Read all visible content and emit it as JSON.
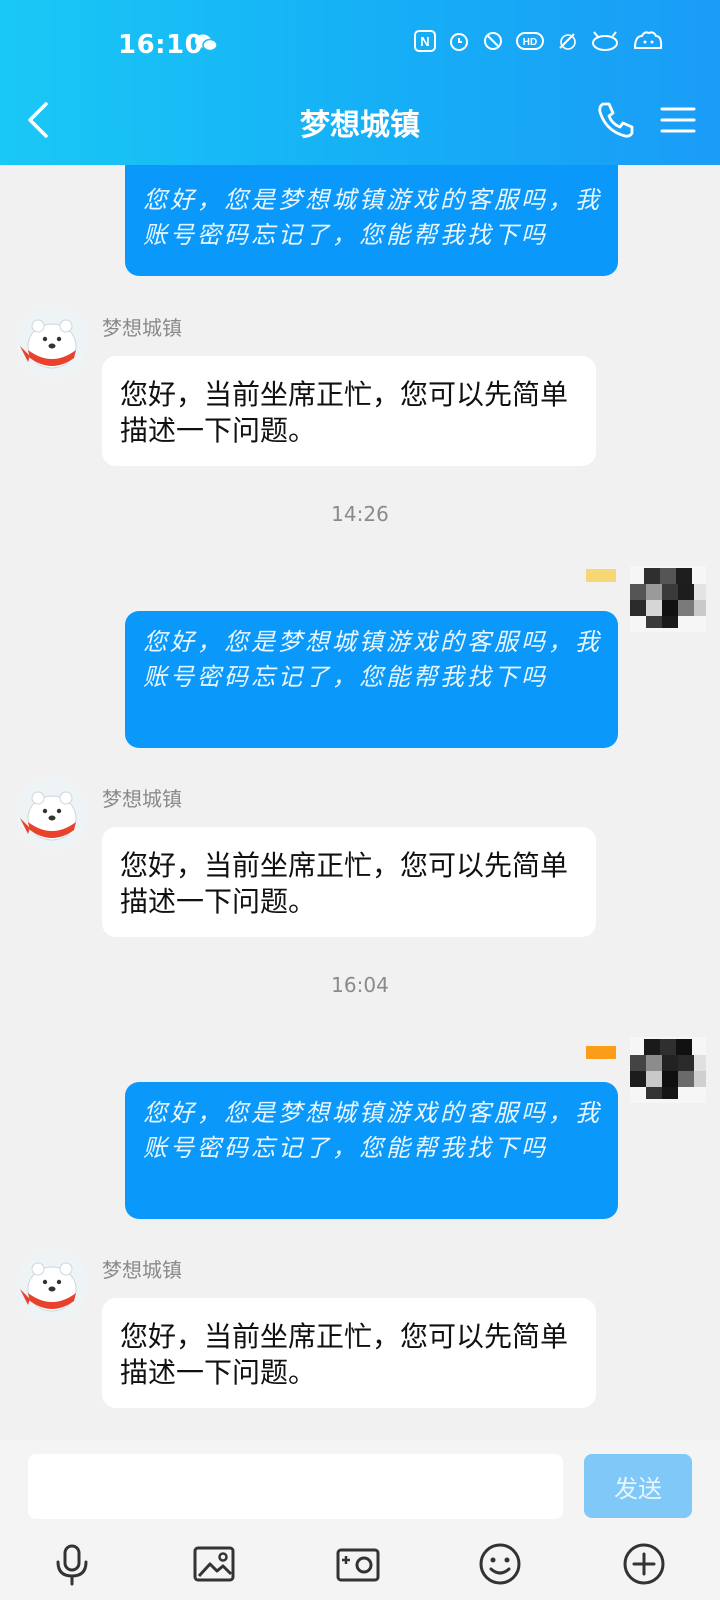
{
  "status_bar": {
    "time": "16:10"
  },
  "header": {
    "title": "梦想城镇"
  },
  "messages": {
    "outgoing_text": "您好，您是梦想城镇游戏的客服吗，我账号密码忘记了，您能帮我找下吗",
    "incoming_sender": "梦想城镇",
    "incoming_text": "您好，当前坐席正忙，您可以先简单描述一下问题。",
    "timestamps": [
      "14:26",
      "16:04"
    ]
  },
  "input": {
    "placeholder": "",
    "send_label": "发送"
  },
  "toolbar": {
    "items": [
      "microphone-icon",
      "image-icon",
      "camera-icon",
      "emoji-icon",
      "plus-icon"
    ]
  },
  "colors": {
    "header_start": "#19c8f5",
    "header_end": "#1a9cf7",
    "outgoing_bubble": "#0a99fb",
    "incoming_bubble": "#ffffff",
    "background": "#f1f1f1",
    "send_button": "#80c8f8",
    "badge_light_yellow": "#f7d774",
    "badge_orange": "#fb9d18"
  }
}
